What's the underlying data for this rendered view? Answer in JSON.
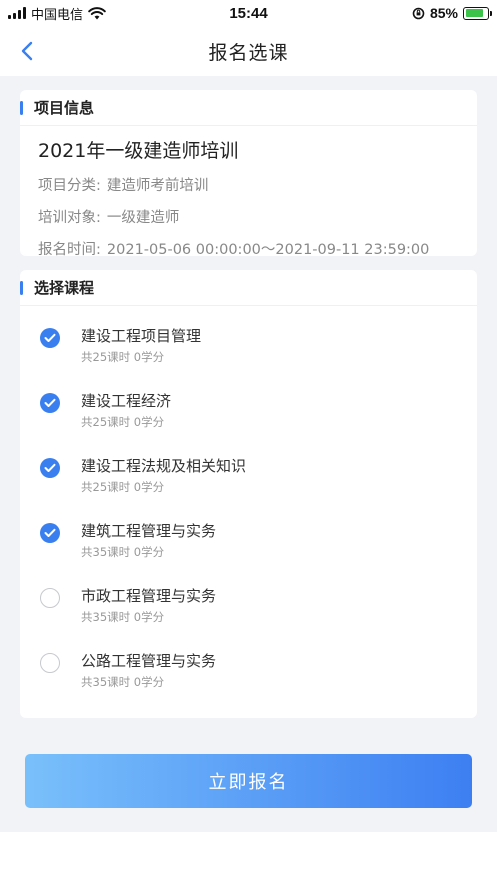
{
  "status_bar": {
    "carrier": "中国电信",
    "time": "15:44",
    "battery_percent": "85%",
    "battery_level": 0.85
  },
  "nav": {
    "title": "报名选课",
    "back_icon": "chevron-left-icon"
  },
  "project_info": {
    "section_title": "项目信息",
    "name": "2021年一级建造师培训",
    "rows": [
      {
        "label": "项目分类:",
        "value": "建造师考前培训"
      },
      {
        "label": "培训对象:",
        "value": "一级建造师"
      },
      {
        "label": "报名时间:",
        "value": "2021-05-06 00:00:00～2021-09-11 23:59:00"
      }
    ]
  },
  "courses": {
    "section_title": "选择课程",
    "items": [
      {
        "name": "建设工程项目管理",
        "meta": "共25课时 0学分",
        "checked": true
      },
      {
        "name": "建设工程经济",
        "meta": "共25课时 0学分",
        "checked": true
      },
      {
        "name": "建设工程法规及相关知识",
        "meta": "共25课时 0学分",
        "checked": true
      },
      {
        "name": "建筑工程管理与实务",
        "meta": "共35课时 0学分",
        "checked": true
      },
      {
        "name": "市政工程管理与实务",
        "meta": "共35课时 0学分",
        "checked": false
      },
      {
        "name": "公路工程管理与实务",
        "meta": "共35课时 0学分",
        "checked": false
      }
    ]
  },
  "submit": {
    "label": "立即报名"
  },
  "colors": {
    "accent": "#3a7ff0",
    "button_gradient_start": "#79c0fb",
    "button_gradient_end": "#3d7ff2",
    "battery_fill": "#3bc34a"
  }
}
